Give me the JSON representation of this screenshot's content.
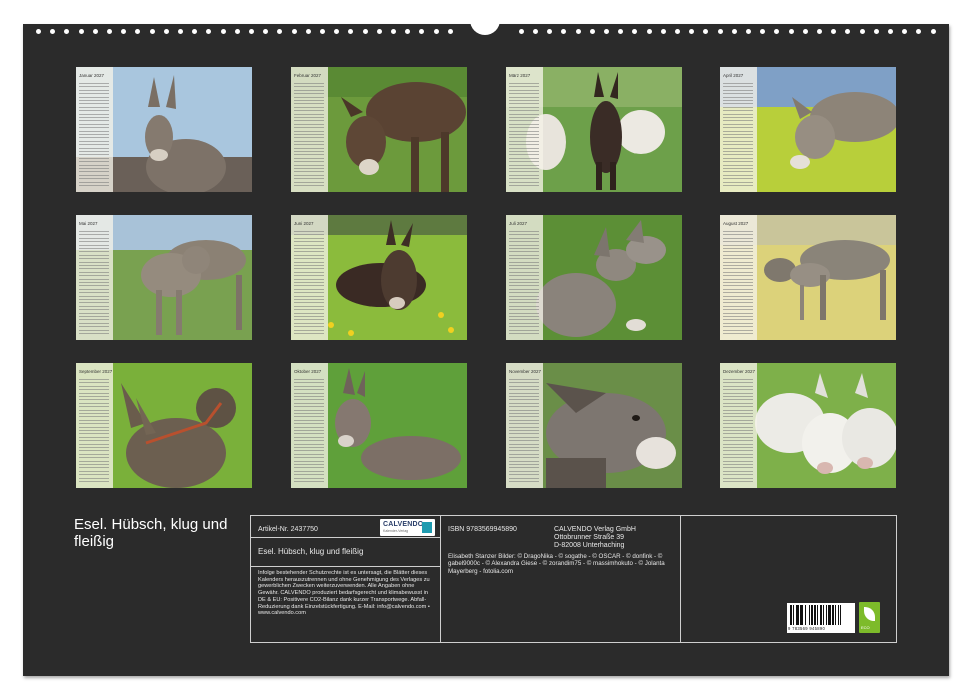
{
  "calendar": {
    "title": "Esel. Hübsch, klug und fleißig",
    "months": [
      {
        "label": "Januar 2027"
      },
      {
        "label": "Februar 2027"
      },
      {
        "label": "März 2027"
      },
      {
        "label": "April 2027"
      },
      {
        "label": "Mai 2027"
      },
      {
        "label": "Juni 2027"
      },
      {
        "label": "Juli 2027"
      },
      {
        "label": "August 2027"
      },
      {
        "label": "September 2027"
      },
      {
        "label": "Oktober 2027"
      },
      {
        "label": "November 2027"
      },
      {
        "label": "Dezember 2027"
      }
    ]
  },
  "info": {
    "article": "Artikel-Nr. 2437750",
    "logo_text": "CALVENDO",
    "logo_sub": "Kalender-Verlag",
    "product_title": "Esel. Hübsch, klug und fleißig",
    "legal_text": "Infolge bestehender Schutzrechte ist es untersagt, die Blätter dieses Kalenders herauszutrennen und ohne Genehmigung des Verlages zu gewerblichen Zwecken weiterzuverwenden. Alle Angaben ohne Gewähr. CALVENDO produziert bedarfsgerecht und klimabewusst in DE & EU: Positivere CO2-Bilanz dank kurzer Transportwege. Abfall-Reduzierung dank Einzelstückfertigung. E-Mail: info@calvendo.com • www.calvendo.com",
    "isbn": "ISBN 9783569945890",
    "publisher_line1": "CALVENDO Verlag GmbH",
    "publisher_line2": "Ottobrunner Straße 39",
    "publisher_line3": "D-82008 Unterhaching",
    "credits": "Elisabeth Stanzer Bilder: © DragoNika - © sogathe - © OSCAR - © donfink - © gabel9000c - © Alexandra Giese - © zorandim75 - © massimhokuto - © Jolanta Mayerberg - fotolia.com",
    "barcode_number": "9 783569 945890",
    "eco_label": "ECO"
  }
}
